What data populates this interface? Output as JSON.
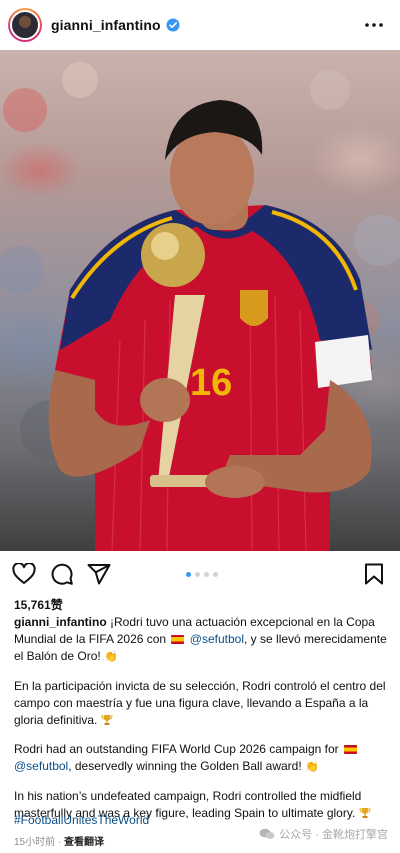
{
  "post": {
    "username": "gianni_infantino",
    "likes": "15,761赞",
    "caption": {
      "p1_before_flag": "¡Rodri tuvo una actuación excepcional en la Copa Mundial de la FIFA 2026 con",
      "p1_mention": "@sefutbol",
      "p1_after": ", y se llevó merecidamente el Balón de Oro!",
      "p2": "En la participación invicta de su selección, Rodri controló el centro del campo con maestría y fue una figura clave, llevando a España a la gloria definitiva.",
      "p3_before_flag": "Rodri had an outstanding FIFA World Cup 2026 campaign for",
      "p3_mention": "@sefutbol",
      "p3_after": ", deservedly winning the Golden Ball award!",
      "p4": "In his nation’s undefeated campaign, Rodri controlled the midfield masterfully and was a key figure, leading Spain to ultimate glory."
    },
    "hashtag": "#FootballUnitesTheWorld",
    "time": "15小时前 ·",
    "see_translation": "查看翻译",
    "carousel": {
      "count": 4,
      "active_index": 0
    },
    "photo": {
      "jersey_number": "16"
    }
  },
  "watermark": "公众号 · 金靴炮打擎宫",
  "colors": {
    "verified": "#3897f0",
    "mention": "#0b4f8a",
    "jersey_red": "#c8102e",
    "jersey_navy": "#1c2a6b",
    "jersey_gold": "#f2b705"
  },
  "icons": [
    "more-options-icon",
    "heart-icon",
    "comment-icon",
    "share-icon",
    "bookmark-icon",
    "verified-badge-icon"
  ]
}
